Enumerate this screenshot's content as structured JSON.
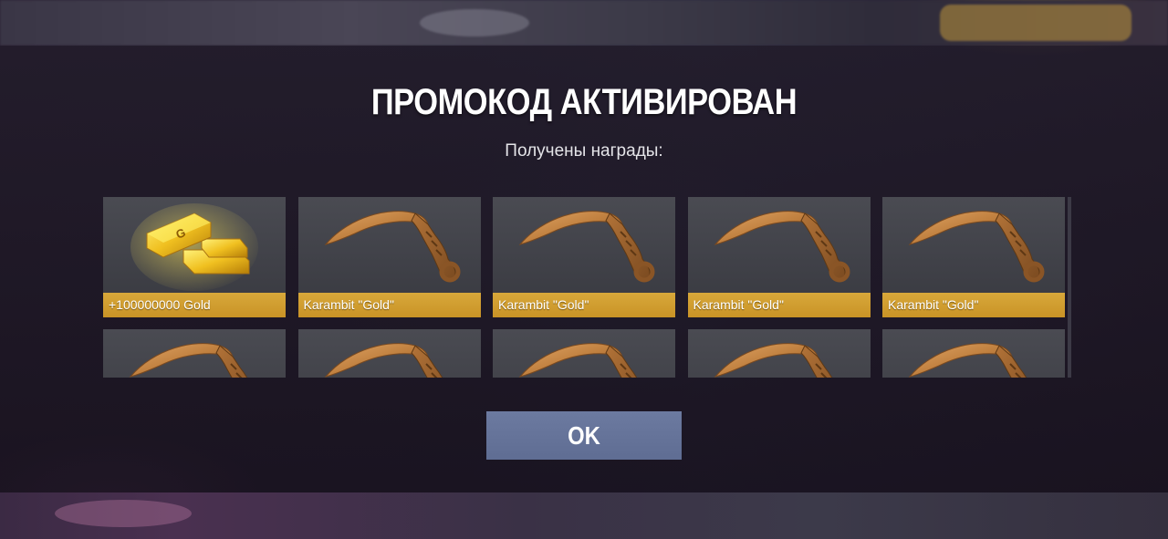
{
  "dialog": {
    "title": "ПРОМОКОД АКТИВИРОВАН",
    "subtitle": "Получены награды:",
    "ok_label": "OK"
  },
  "rewards": [
    {
      "icon": "gold-bars-icon",
      "label": "+100000000 Gold"
    },
    {
      "icon": "karambit-gold-icon",
      "label": "Karambit \"Gold\""
    },
    {
      "icon": "karambit-gold-icon",
      "label": "Karambit \"Gold\""
    },
    {
      "icon": "karambit-gold-icon",
      "label": "Karambit \"Gold\""
    },
    {
      "icon": "karambit-gold-icon",
      "label": "Karambit \"Gold\""
    },
    {
      "icon": "karambit-gold-icon",
      "label": ""
    },
    {
      "icon": "karambit-gold-icon",
      "label": ""
    },
    {
      "icon": "karambit-gold-icon",
      "label": ""
    },
    {
      "icon": "karambit-gold-icon",
      "label": ""
    },
    {
      "icon": "karambit-gold-icon",
      "label": ""
    }
  ],
  "colors": {
    "label_bar": "#d0a030",
    "ok_button": "#6573a0",
    "card_bg": "#45464d",
    "knife": "#c98a45"
  }
}
